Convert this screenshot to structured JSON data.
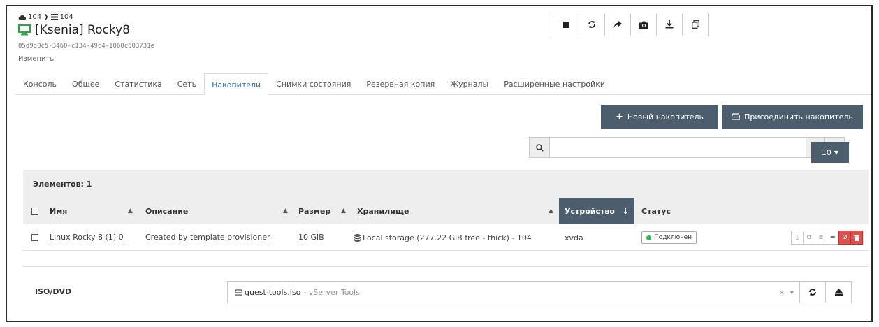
{
  "breadcrumb": {
    "pool": "104",
    "host": "104"
  },
  "vm": {
    "name": "[Ksenia] Rocky8",
    "uuid": "85d9d0c5-3460-c134-49c4-1060c603731e",
    "edit_label": "Изменить"
  },
  "toolbar": {
    "icons": [
      "stop-icon",
      "refresh-icon",
      "share-icon",
      "camera-icon",
      "download-icon",
      "copy-icon"
    ]
  },
  "tabs": [
    {
      "label": "Консоль",
      "active": false
    },
    {
      "label": "Общее",
      "active": false
    },
    {
      "label": "Статистика",
      "active": false
    },
    {
      "label": "Сеть",
      "active": false
    },
    {
      "label": "Накопители",
      "active": true
    },
    {
      "label": "Снимки состояния",
      "active": false
    },
    {
      "label": "Резервная копия",
      "active": false
    },
    {
      "label": "Журналы",
      "active": false
    },
    {
      "label": "Расширенные настройки",
      "active": false
    }
  ],
  "actions": {
    "new_disk": "Новый накопитель",
    "attach_disk": "Присоединить накопитель"
  },
  "search": {
    "value": "",
    "placeholder": ""
  },
  "pager": {
    "page_size": "10"
  },
  "table": {
    "count_label": "Элементов: 1",
    "columns": {
      "name": "Имя",
      "description": "Описание",
      "size": "Размер",
      "storage": "Хранилище",
      "device": "Устройство",
      "status": "Статус"
    },
    "rows": [
      {
        "name": "Linux Rocky 8 (1) 0",
        "description": "Created by template provisioner",
        "size": "10 GiB",
        "storage": "Local storage (277.22 GiB free - thick) - 104",
        "device": "xvda",
        "status": "Подключен"
      }
    ]
  },
  "iso": {
    "label": "ISO/DVD",
    "selected": "guest-tools.iso",
    "selected_sub": "- vServer Tools"
  },
  "colors": {
    "primary_dark": "#4c5d6d",
    "accent_blue": "#3a6fb0",
    "danger": "#d9534f",
    "status_green": "#2eb84b"
  }
}
